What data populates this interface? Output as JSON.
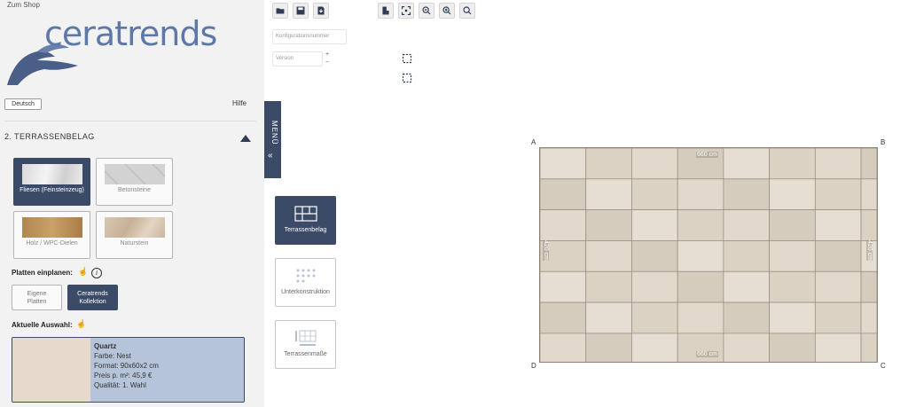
{
  "header": {
    "shop_link": "Zum Shop",
    "language": "Deutsch",
    "help": "Hilfe"
  },
  "logo": {
    "brand": "ceratrends"
  },
  "section": {
    "title": "2. TERRASSENBELAG"
  },
  "categories": [
    {
      "label": "Fliesen (Feinsteinzeug)",
      "active": true
    },
    {
      "label": "Betonsteine",
      "active": false
    },
    {
      "label": "Holz / WPC-Dielen",
      "active": false
    },
    {
      "label": "Naturstein",
      "active": false
    }
  ],
  "planning": {
    "label": "Platten einplanen:",
    "own_plates": "Eigene\nPlatten",
    "collection": "Ceratrends\nKollektion"
  },
  "current": {
    "label": "Aktuelle Auswahl:",
    "name": "Quartz",
    "color": "Farbe: Nest",
    "format": "Format: 90x60x2 cm",
    "price": "Preis p. m²: 45,9 €",
    "quality": "Qualität: 1. Wahl"
  },
  "menu_tab": {
    "label": "MENÜ"
  },
  "toolbar": {
    "left_icons": [
      "folder-icon",
      "save-icon",
      "download-icon"
    ],
    "right_icons": [
      "page-settings-icon",
      "zoom-fit-icon",
      "zoom-out-icon",
      "zoom-in-icon",
      "zoom-reset-icon"
    ]
  },
  "fields": {
    "config_placeholder": "Konfigurationsnummer",
    "version_placeholder": "Version",
    "plus": "+",
    "minus": "−"
  },
  "tools": [
    {
      "label": "Terrassenbelag",
      "active": true
    },
    {
      "label": "Unterkonstruktion",
      "active": false
    },
    {
      "label": "Terrassenmaße",
      "active": false
    }
  ],
  "plan": {
    "corners": {
      "a": "A",
      "b": "B",
      "c": "C",
      "d": "D"
    },
    "width_label": "660 cm",
    "height_label": "420 cm",
    "columns": 7,
    "rows": 7
  },
  "colors": {
    "accent": "#3a4a67",
    "selected_card": "#b6c4d9"
  }
}
